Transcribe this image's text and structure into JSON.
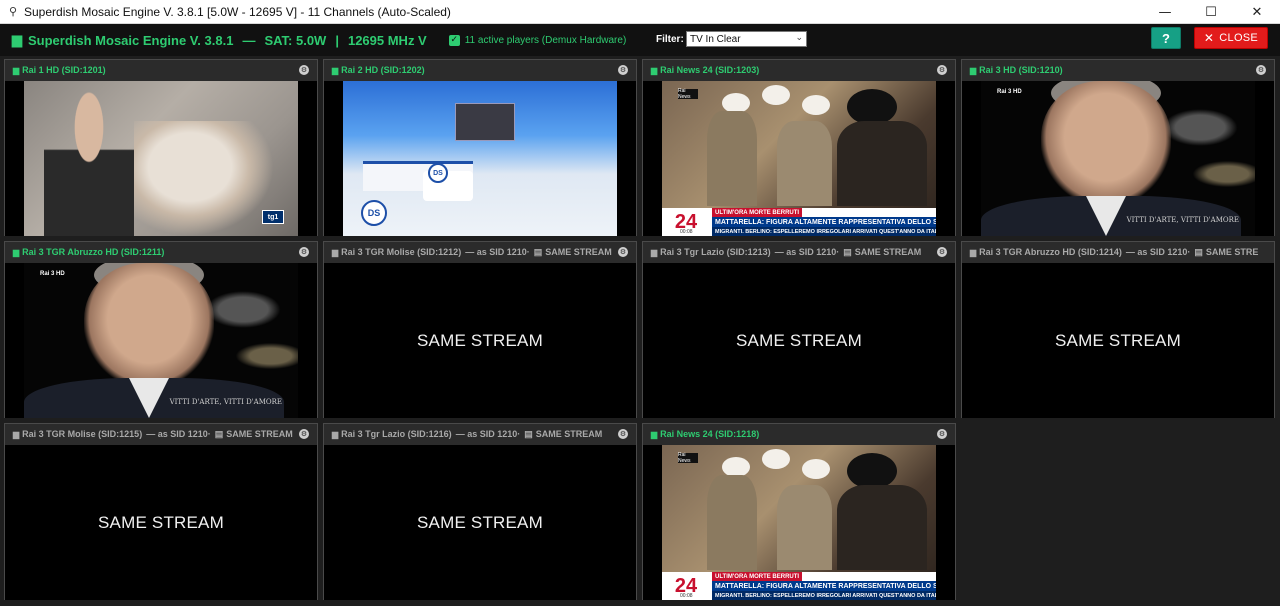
{
  "window": {
    "title": "Superdish Mosaic Engine V. 3.8.1 [5.0W - 12695 V] - 11 Channels (Auto-Scaled)",
    "controls": {
      "minimize": "—",
      "maximize": "☐",
      "close": "✕"
    }
  },
  "header": {
    "brand": "Superdish Mosaic Engine V. 3.8.1",
    "sep1": "—",
    "sat": "SAT: 5.0W",
    "sep2": "|",
    "freq": "12695 MHz V",
    "active_players": "11 active players (Demux Hardware)",
    "filter_label": "Filter:",
    "filter_value": "TV In Clear",
    "help_label": "?",
    "close_label": "CLOSE",
    "accent_color": "#2ecc71",
    "close_color": "#e21b1b",
    "help_color": "#16a085"
  },
  "tiles": [
    {
      "label": "Rai 1 HD (SID:1201)",
      "dup": false,
      "scene": "street",
      "logo": "tg1"
    },
    {
      "label": "Rai 2 HD (SID:1202)",
      "dup": false,
      "scene": "studio",
      "ds": "DS"
    },
    {
      "label": "Rai News 24 (SID:1203)",
      "dup": false,
      "scene": "news"
    },
    {
      "label": "Rai 3 HD (SID:1210)",
      "dup": false,
      "scene": "portrait"
    },
    {
      "label": "Rai 3 TGR Abruzzo HD (SID:1211)",
      "dup": false,
      "scene": "portrait"
    },
    {
      "label": "Rai 3 TGR Molise (SID:1212)",
      "dup": true,
      "ref": "— as SID 1210",
      "tag": "SAME STREAM"
    },
    {
      "label": "Rai 3 Tgr Lazio (SID:1213)",
      "dup": true,
      "ref": "— as SID 1210",
      "tag": "SAME STREAM"
    },
    {
      "label": "Rai 3 TGR Abruzzo HD (SID:1214)",
      "dup": true,
      "ref": "— as SID 1210",
      "tag": "SAME STRE"
    },
    {
      "label": "Rai 3 TGR Molise (SID:1215)",
      "dup": true,
      "ref": "— as SID 1210",
      "tag": "SAME STREAM"
    },
    {
      "label": "Rai 3 Tgr Lazio (SID:1216)",
      "dup": true,
      "ref": "— as SID 1210",
      "tag": "SAME STREAM"
    },
    {
      "label": "Rai News 24 (SID:1218)",
      "dup": false,
      "scene": "news"
    }
  ],
  "same_stream_text": "SAME STREAM",
  "news_ticker": {
    "number": "24",
    "time": "00:08",
    "flash": "ULTIM'ORA MORTE BERRUTI",
    "headline": "MATTARELLA: FIGURA ALTAMENTE RAPPRESENTATIVA DELLO SPORT ITALIANO",
    "subline": "MIGRANTI. BERLINO: ESPELLEREMO IRREGOLARI ARRIVATI QUEST'ANNO DA ITALIA"
  },
  "brand_tags": {
    "rai2": "Rai 2 HD",
    "rainews": "Rai News",
    "rai3": "Rai 3 HD"
  },
  "portrait_caption": "VITTI D'ARTE, VITTI D'AMORE"
}
